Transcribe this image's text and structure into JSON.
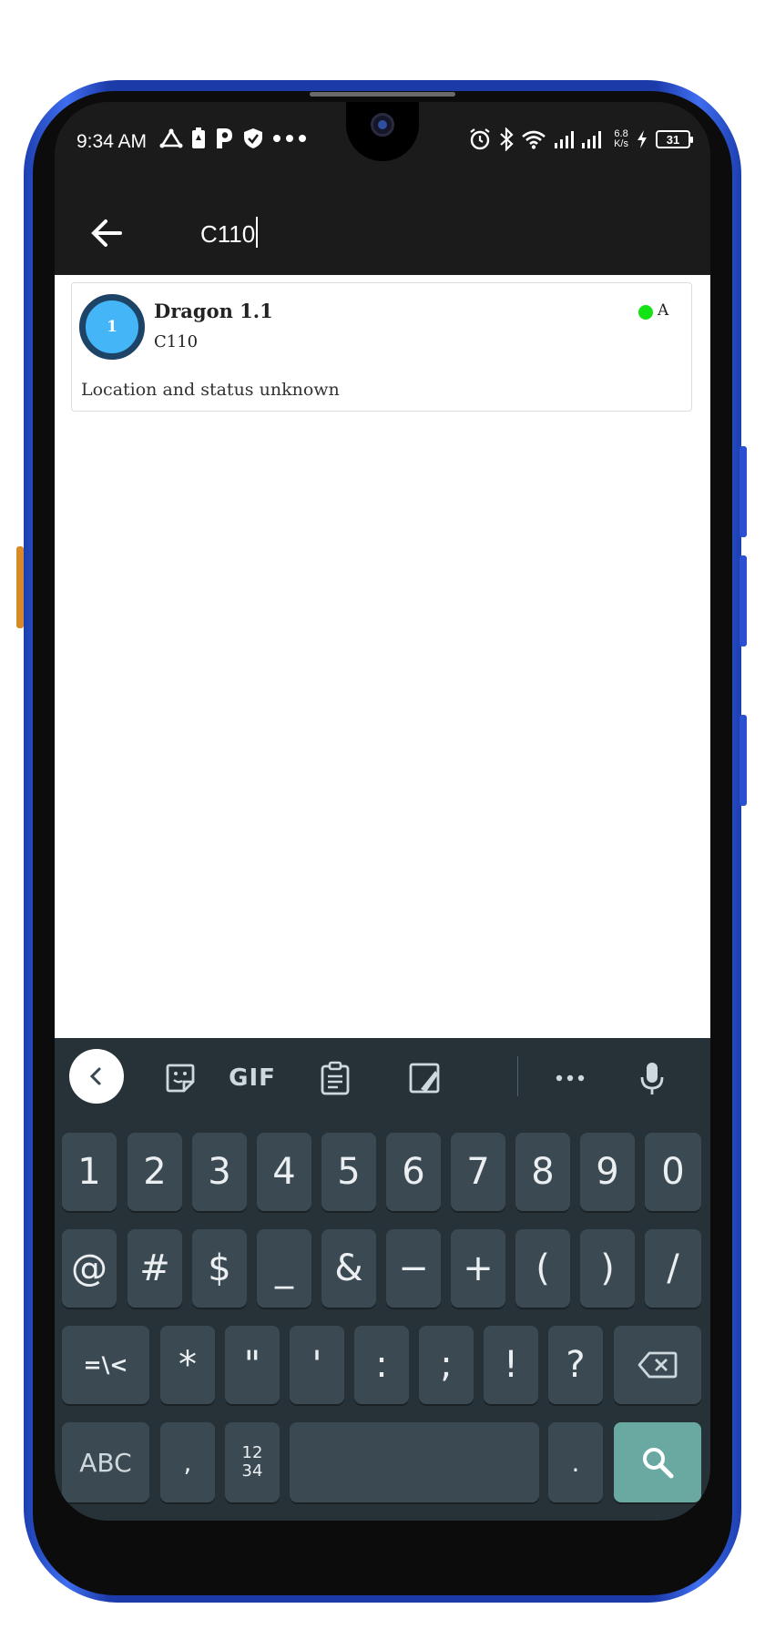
{
  "status_bar": {
    "time": "9:34 AM",
    "left_icons": [
      "delta-icon",
      "battery-saver-icon",
      "parking-icon",
      "shield-check-icon",
      "more-dots-icon"
    ],
    "net_speed_value": "6.8",
    "net_speed_unit": "K/s",
    "battery_level": "31",
    "right_icons": [
      "alarm-icon",
      "bluetooth-icon",
      "wifi-icon",
      "signal-icon",
      "charging-icon"
    ]
  },
  "app_bar": {
    "search_value": "C110",
    "back_icon": "arrow-back-icon"
  },
  "results": [
    {
      "avatar_number": "1",
      "title": "Dragon 1.1",
      "subtitle": "C110",
      "status_letter": "A",
      "status_color": "#13e313",
      "description": "Location and status unknown"
    }
  ],
  "keyboard": {
    "toolbar": {
      "gif_label": "GIF",
      "icons": [
        "chevron-left-icon",
        "sticker-icon",
        "gif-icon",
        "clipboard-icon",
        "edit-icon",
        "more-icon",
        "microphone-icon"
      ]
    },
    "row1": [
      "1",
      "2",
      "3",
      "4",
      "5",
      "6",
      "7",
      "8",
      "9",
      "0"
    ],
    "row2": [
      "@",
      "#",
      "$",
      "_",
      "&",
      "−",
      "+",
      "(",
      ")",
      "/"
    ],
    "row3": [
      "=\\<",
      "*",
      "\"",
      "'",
      ":",
      ";",
      "!",
      "?"
    ],
    "row4": {
      "abc": "ABC",
      "comma": ",",
      "numswitch_top": "12",
      "numswitch_bottom": "34",
      "period": "."
    }
  },
  "colors": {
    "app_bar": "#1b1b1b",
    "keyboard_bg": "#263238",
    "key_bg": "#3b4a52",
    "enter_key": "#6aa9a2",
    "avatar_fill": "#44b6f7",
    "avatar_ring": "#1d4466"
  }
}
